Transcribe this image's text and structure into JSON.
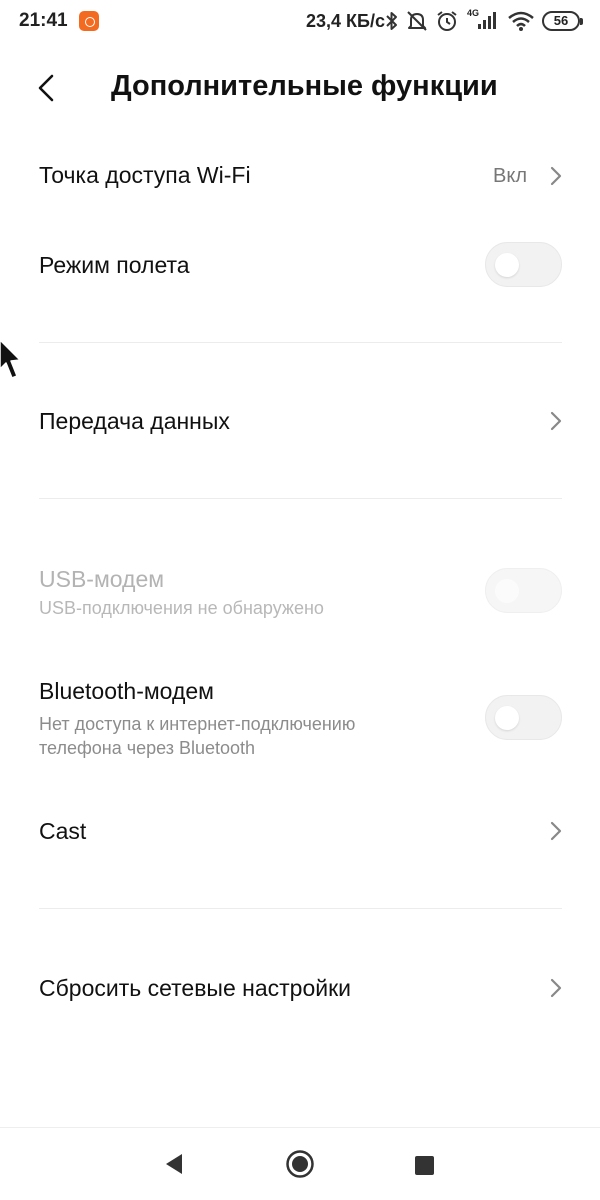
{
  "status_bar": {
    "time": "21:41",
    "speed": "23,4 КБ/с",
    "network_type": "4G",
    "battery": "56",
    "icons": [
      "app-notification-icon",
      "bluetooth-icon",
      "mute-icon",
      "alarm-icon",
      "cellular-signal-icon",
      "wifi-icon",
      "battery-icon"
    ]
  },
  "header": {
    "title": "Дополнительные функции",
    "back_icon": "chevron-left-icon"
  },
  "rows": {
    "wifi_hotspot": {
      "title": "Точка доступа Wi-Fi",
      "value": "Вкл"
    },
    "airplane_mode": {
      "title": "Режим полета",
      "enabled": false
    },
    "data_transfer": {
      "title": "Передача данных"
    },
    "usb_modem": {
      "title": "USB-модем",
      "subtitle": "USB-подключения не обнаружено",
      "enabled": false,
      "disabled": true
    },
    "bluetooth_modem": {
      "title": "Bluetooth-модем",
      "subtitle_line1": "Нет доступа к интернет-подключению",
      "subtitle_line2": "телефона через Bluetooth",
      "enabled": false
    },
    "cast": {
      "title": "Cast"
    },
    "reset_network": {
      "title": "Сбросить сетевые настройки"
    }
  },
  "nav_bar": {
    "icons": [
      "nav-back-icon",
      "nav-home-icon",
      "nav-recents-icon"
    ]
  },
  "colors": {
    "background": "#ffffff",
    "text_primary": "#111111",
    "text_secondary": "#8c8c8c",
    "text_disabled": "#b3b3b3",
    "toggle_off": "#f2f2f2",
    "divider": "#ececec"
  }
}
